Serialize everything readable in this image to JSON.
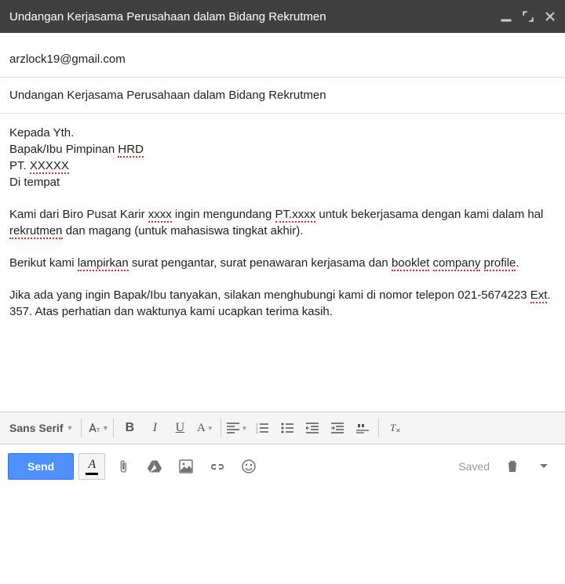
{
  "window": {
    "title": "Undangan Kerjasama Perusahaan dalam Bidang Rekrutmen"
  },
  "fields": {
    "to": "arzlock19@gmail.com",
    "subject": "Undangan Kerjasama Perusahaan dalam Bidang Rekrutmen"
  },
  "body": {
    "line1": "Kepada Yth.",
    "line2_pre": "Bapak/Ibu Pimpinan ",
    "line2_sp1": "HRD",
    "line3_pre": "PT. ",
    "line3_sp1": "XXXXX",
    "line4": "Di tempat",
    "p2_a": "Kami dari Biro Pusat Karir ",
    "p2_sp1": "xxxx",
    "p2_b": " ingin mengundang ",
    "p2_sp2": "PT.xxxx",
    "p2_c": " untuk bekerjasama dengan kami dalam hal ",
    "p2_sp3": "rekrutmen",
    "p2_d": " dan magang (untuk mahasiswa tingkat akhir).",
    "p3_a": "Berikut kami ",
    "p3_sp1": "lampirkan",
    "p3_b": " surat pengantar, surat penawaran kerjasama dan ",
    "p3_sp2": "booklet",
    "p3_c": " ",
    "p3_sp3": "company",
    "p3_d": " ",
    "p3_sp4": "profile",
    "p3_e": ".",
    "p4_a": "Jika ada yang ingin Bapak/Ibu tanyakan, silakan menghubungi kami di nomor telepon 021-5674223 ",
    "p4_sp1": "Ext",
    "p4_b": ". 357. Atas perhatian dan waktunya kami ucapkan terima kasih."
  },
  "toolbar": {
    "font": "Sans Serif",
    "bold": "B",
    "italic": "I",
    "underline": "U"
  },
  "actions": {
    "send": "Send",
    "saved": "Saved"
  }
}
